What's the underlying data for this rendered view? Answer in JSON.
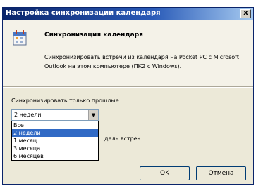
{
  "window": {
    "title": "Настройка синхронизации календаря",
    "close_glyph": "x"
  },
  "header": {
    "icon": "calendar-icon",
    "title": "Синхронизация календаря",
    "description": "Синхронизировать встречи из календаря на Pocket PC с Microsoft Outlook на этом компьютере (ПК2 с Windows)."
  },
  "sync": {
    "label": "Синхронизировать только прошлые",
    "selected": "2 недели",
    "options": [
      "Все",
      "2 недели",
      "1 месяц",
      "3 месяца",
      "6 месяцев"
    ],
    "selected_index": 1,
    "partial_checkbox_text": "дель встреч"
  },
  "buttons": {
    "ok": "OK",
    "cancel": "Отмена"
  },
  "colors": {
    "titlebar": "#0a246a",
    "dialog_bg": "#ece9d8",
    "selection": "#316ac5"
  }
}
